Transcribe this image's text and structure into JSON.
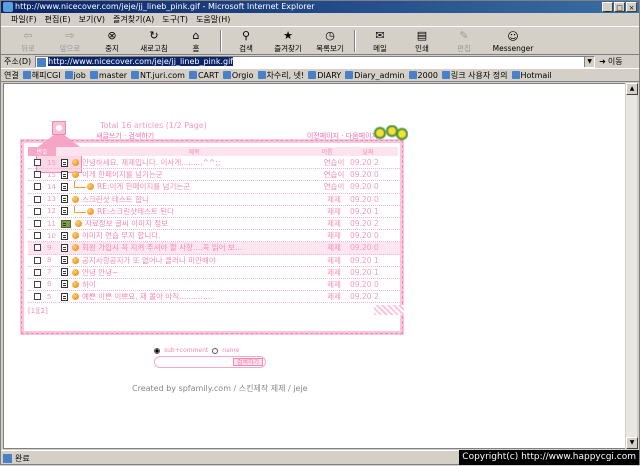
{
  "window": {
    "title": "http://www.nicecover.com/jeje/jj_lineb_pink.gif - Microsoft Internet Explorer"
  },
  "menu": [
    "파일(F)",
    "편집(E)",
    "보기(V)",
    "즐겨찾기(A)",
    "도구(T)",
    "도움말(H)"
  ],
  "toolbar": [
    {
      "label": "뒤로",
      "icon": "back-arrow-icon",
      "enabled": false
    },
    {
      "label": "앞으로",
      "icon": "forward-arrow-icon",
      "enabled": false
    },
    {
      "label": "중지",
      "icon": "stop-icon",
      "enabled": true
    },
    {
      "label": "새로고침",
      "icon": "refresh-icon",
      "enabled": true
    },
    {
      "label": "홈",
      "icon": "home-icon",
      "enabled": true
    },
    {
      "label": "검색",
      "icon": "search-icon",
      "enabled": true
    },
    {
      "label": "즐겨찾기",
      "icon": "favorites-icon",
      "enabled": true
    },
    {
      "label": "목록보기",
      "icon": "history-icon",
      "enabled": true
    },
    {
      "label": "메일",
      "icon": "mail-icon",
      "enabled": true
    },
    {
      "label": "인쇄",
      "icon": "print-icon",
      "enabled": true
    },
    {
      "label": "편집",
      "icon": "edit-icon",
      "enabled": false
    },
    {
      "label": "Messenger",
      "icon": "messenger-icon",
      "enabled": true
    }
  ],
  "address": {
    "label": "주소(D)",
    "url": "http://www.nicecover.com/jeje/jj_lineb_pink.gif",
    "go": "이동"
  },
  "links": {
    "label": "연결",
    "items": [
      "해피CGI",
      "job",
      "master",
      "NT.juri.com",
      "CART",
      "Orgio",
      "차수리, 넷!",
      "DIARY",
      "Diary_admin",
      "2000",
      "링크 사용자 정의",
      "Hotmail"
    ]
  },
  "board": {
    "title": "Total 16 articles (1/2 Page)",
    "nav_left": "새글쓰기 · 검색하기",
    "nav_right": "이전페이지 · 다음페이지",
    "header": {
      "no": "번호",
      "subject": "제목",
      "name": "이름",
      "date": "날짜",
      "hits": "조회"
    },
    "rows": [
      {
        "num": "15",
        "reply": false,
        "new": false,
        "subject": "안녕하세요. 제제입니다. 이사게.........^^;;",
        "name": "연습이",
        "date": "09.20",
        "hits": "2",
        "highlight": false
      },
      {
        "num": "15",
        "reply": false,
        "new": false,
        "subject": "이게 한페이지를 넘기는군",
        "name": "연습이",
        "date": "09.20",
        "hits": "0",
        "highlight": false
      },
      {
        "num": "14",
        "reply": true,
        "new": false,
        "subject": "RE:이게 한페이지를 넘기는군",
        "name": "연습이",
        "date": "09.20",
        "hits": "0",
        "highlight": false
      },
      {
        "num": "13",
        "reply": false,
        "new": false,
        "subject": "스크린샷 테스트 합니",
        "name": "제제",
        "date": "09.20",
        "hits": "0",
        "highlight": false
      },
      {
        "num": "12",
        "reply": true,
        "new": false,
        "subject": "RE:스크린샷테스트 된다",
        "name": "제제",
        "date": "09.20",
        "hits": "1",
        "highlight": false
      },
      {
        "num": "11",
        "reply": false,
        "new": true,
        "subject": "자료정보 글씨 이미지 정보",
        "name": "제제",
        "date": "09.20",
        "hits": "2",
        "highlight": false
      },
      {
        "num": "10",
        "reply": false,
        "new": false,
        "subject": "이미지 연습 무지 합니다.",
        "name": "제제",
        "date": "09.20",
        "hits": "0",
        "highlight": false
      },
      {
        "num": "9",
        "reply": false,
        "new": false,
        "subject": "회원 가입시 꼭 지켜 주셔야 할 사항....꼭 읽어 보...",
        "name": "제제",
        "date": "09.20",
        "hits": "0",
        "highlight": true
      },
      {
        "num": "8",
        "reply": false,
        "new": false,
        "subject": "공지사항공지가 또 없어나 클러니 미안해야",
        "name": "제제",
        "date": "09.20",
        "hits": "1",
        "highlight": false
      },
      {
        "num": "7",
        "reply": false,
        "new": false,
        "subject": "안녕 안녕~",
        "name": "제제",
        "date": "09.20",
        "hits": "1",
        "highlight": false
      },
      {
        "num": "6",
        "reply": false,
        "new": false,
        "subject": "하이",
        "name": "제제",
        "date": "09.20",
        "hits": "0",
        "highlight": false
      },
      {
        "num": "5",
        "reply": false,
        "new": false,
        "subject": "예쁜 이쁜 이쁘요, 재 몰아 아직..............",
        "name": "제제",
        "date": "09.20",
        "hits": "2",
        "highlight": false
      }
    ],
    "pager": "[1][2]",
    "search": {
      "opt1": "sub+comment",
      "opt2": "name",
      "button": "검색하기"
    },
    "credit": "Created by spfamily.com / 스킨제작 제제 / jeje"
  },
  "status": {
    "text": "완료",
    "copyright": "Copyright(c) http://www.happycgi.com"
  },
  "colors": {
    "accent": "#f48ab4",
    "frame": "#fbc6db",
    "titlebar": "#0a246a"
  }
}
